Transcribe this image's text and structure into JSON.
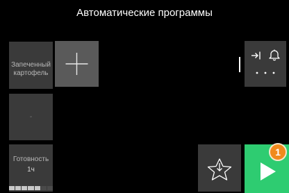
{
  "header": {
    "title": "Автоматические программы"
  },
  "tiles": {
    "program": {
      "line1": "Запеченный",
      "line2": "картофель"
    },
    "empty": {
      "label": "-"
    },
    "ready": {
      "label": "Готовность",
      "value": "1ч",
      "progress": 0.7
    }
  },
  "icons": {
    "add": "plus-icon",
    "send": "send-to-icon",
    "bell": "bell-icon",
    "more": "more-dots-icon",
    "favorite": "favorite-star-icon",
    "play": "play-icon"
  },
  "badge": {
    "value": "1"
  },
  "colors": {
    "background": "#000000",
    "tile": "#3a3a3a",
    "tile_active": "#5a5a5a",
    "play": "#2ecc71",
    "badge": "#f08a1c",
    "progress_on": "#c8c8c8",
    "progress_off": "#4a4a4a"
  }
}
